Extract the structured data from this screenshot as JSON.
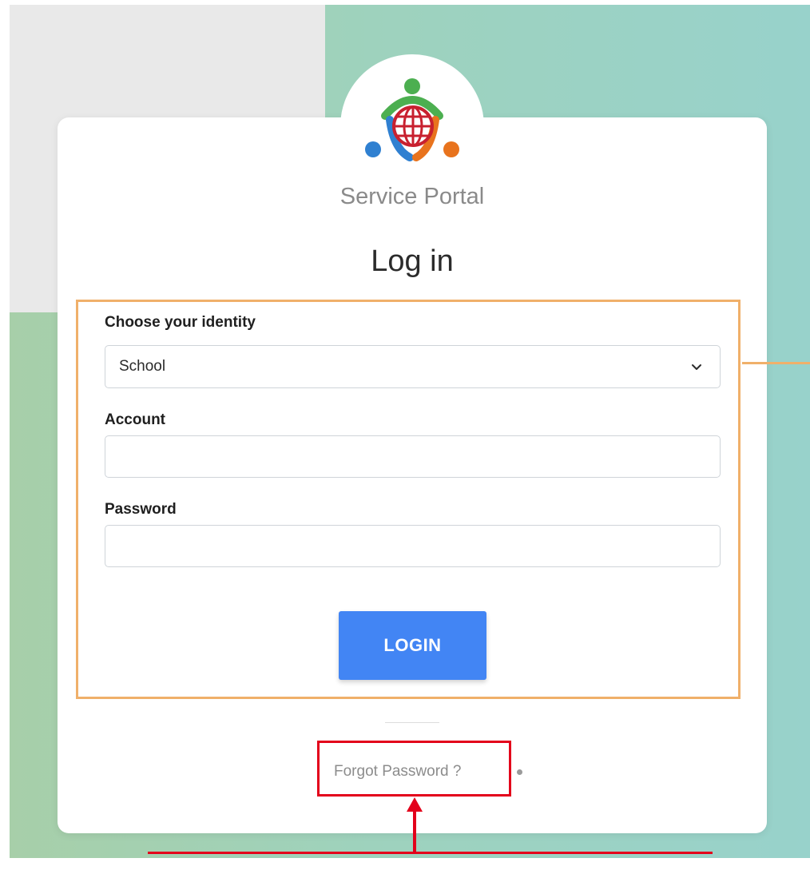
{
  "app": {
    "name": "Service Portal"
  },
  "page": {
    "title": "Log in"
  },
  "form": {
    "identity_label": "Choose your identity",
    "identity_value": "School",
    "account_label": "Account",
    "account_value": "",
    "password_label": "Password",
    "password_value": "",
    "login_button": "LOGIN"
  },
  "footer": {
    "forgot_password": "Forgot Password ?"
  },
  "colors": {
    "primary_button": "#4285f4",
    "highlight_orange": "#f0b06a",
    "highlight_red": "#e3001b",
    "logo_green": "#4caf50",
    "logo_blue": "#2f80d1",
    "logo_orange": "#e8731d",
    "logo_red": "#c8202f"
  },
  "icons": {
    "logo": "service-portal-logo-icon",
    "select_caret": "chevron-down-icon"
  }
}
